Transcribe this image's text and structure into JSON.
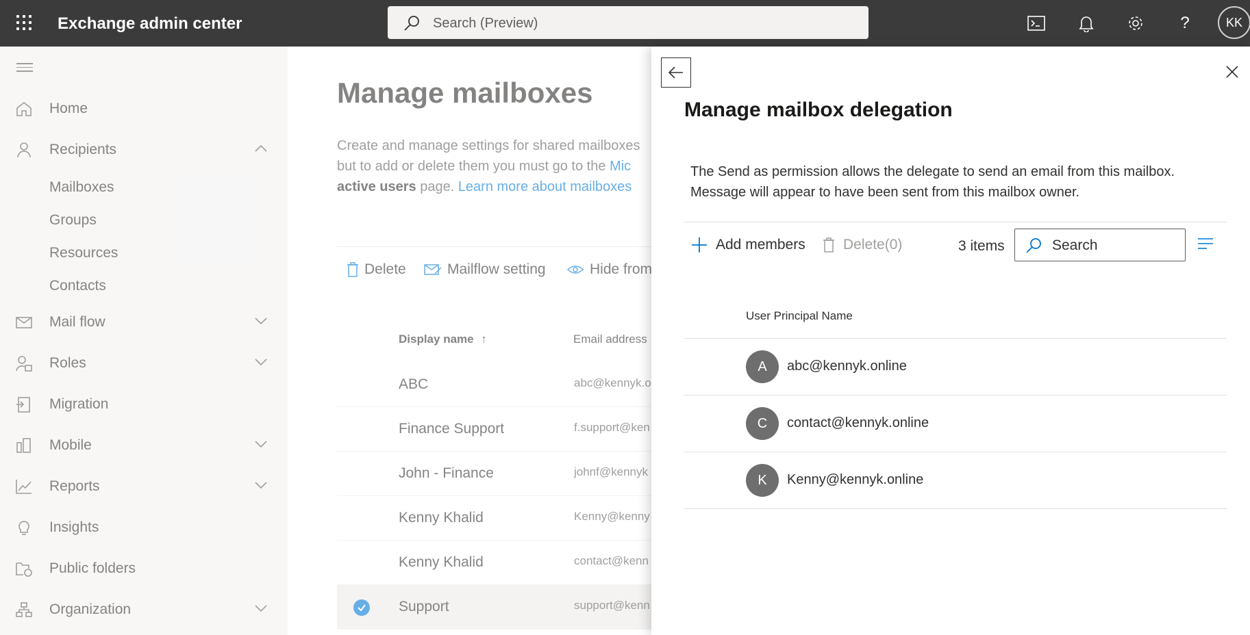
{
  "topbar": {
    "app_title": "Exchange admin center",
    "search_placeholder": "Search (Preview)",
    "user_initials": "KK"
  },
  "nav": {
    "home": "Home",
    "recipients": "Recipients",
    "recipients_sub": [
      "Mailboxes",
      "Groups",
      "Resources",
      "Contacts"
    ],
    "mail_flow": "Mail flow",
    "roles": "Roles",
    "migration": "Migration",
    "mobile": "Mobile",
    "reports": "Reports",
    "insights": "Insights",
    "public_folders": "Public folders",
    "organization": "Organization"
  },
  "main": {
    "title": "Manage mailboxes",
    "desc_line1": "Create and manage settings for shared mailboxes",
    "desc_line2_prefix": "but to add or delete them you must go to the ",
    "desc_link_mic": "Mic",
    "desc_bold": "active users",
    "desc_line3_mid": " page. ",
    "desc_learn_more": "Learn more about mailboxes",
    "cmd_delete": "Delete",
    "cmd_mailflow": "Mailflow setting",
    "cmd_hide": "Hide from",
    "col_display_name": "Display name",
    "col_sort_arrow": "↑",
    "col_email": "Email address",
    "rows": [
      {
        "name": "ABC",
        "email": "abc@kennyk.o"
      },
      {
        "name": "Finance Support",
        "email": "f.support@ken"
      },
      {
        "name": "John - Finance",
        "email": "johnf@kennyk"
      },
      {
        "name": "Kenny Khalid",
        "email": "Kenny@kenny"
      },
      {
        "name": "Kenny Khalid",
        "email": "contact@kenn"
      },
      {
        "name": "Support",
        "email": "support@kenn"
      }
    ]
  },
  "panel": {
    "title": "Manage mailbox delegation",
    "desc_line1": "The Send as permission allows the delegate to send an email from this mailbox.",
    "desc_line2": "Message will appear to have been sent from this mailbox owner.",
    "add_members": "Add members",
    "delete": "Delete(0)",
    "items_count": "3 items",
    "search_placeholder": "Search",
    "col_upn": "User Principal Name",
    "members": [
      {
        "initial": "A",
        "upn": "abc@kennyk.online"
      },
      {
        "initial": "C",
        "upn": "contact@kennyk.online"
      },
      {
        "initial": "K",
        "upn": "Kenny@kennyk.online"
      }
    ]
  },
  "colors": {
    "topbar": "#3b3b3b",
    "accent": "#0078d4",
    "nav_bg": "#f3f2f1",
    "avatar": "#6e6e6e"
  }
}
